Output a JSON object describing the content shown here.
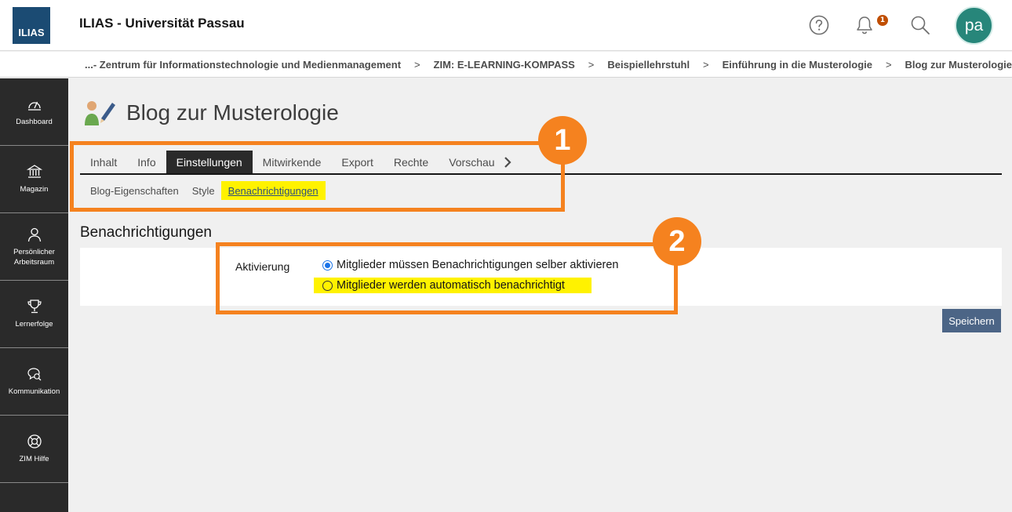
{
  "header": {
    "logo_text": "ILIAS",
    "app_title": "ILIAS - Universität Passau",
    "notification_count": "1",
    "avatar_initials": "pa",
    "icons": [
      "help-icon",
      "bell-icon",
      "search-icon"
    ]
  },
  "breadcrumb": {
    "items": [
      "...- Zentrum für Informationstechnologie und Medienmanagement",
      "ZIM: E-LEARNING-KOMPASS",
      "Beispiellehrstuhl",
      "Einführung in die Musterologie",
      "Blog zur Musterologie"
    ],
    "separator": ">"
  },
  "sidebar": {
    "items": [
      {
        "label": "Dashboard",
        "icon": "dashboard-icon"
      },
      {
        "label": "Magazin",
        "icon": "library-icon"
      },
      {
        "label": "Persönlicher Arbeitsraum",
        "icon": "person-icon"
      },
      {
        "label": "Lernerfolge",
        "icon": "trophy-icon"
      },
      {
        "label": "Kommunikation",
        "icon": "chat-icon"
      },
      {
        "label": "ZIM Hilfe",
        "icon": "lifebuoy-icon"
      }
    ]
  },
  "main": {
    "page_title": "Blog zur Musterologie",
    "tabs": [
      {
        "label": "Inhalt",
        "active": false
      },
      {
        "label": "Info",
        "active": false
      },
      {
        "label": "Einstellungen",
        "active": true
      },
      {
        "label": "Mitwirkende",
        "active": false
      },
      {
        "label": "Export",
        "active": false
      },
      {
        "label": "Rechte",
        "active": false
      },
      {
        "label": "Vorschau",
        "active": false
      }
    ],
    "subtabs": [
      {
        "label": "Blog-Eigenschaften",
        "active": false
      },
      {
        "label": "Style",
        "active": false
      },
      {
        "label": "Benachrichtigungen",
        "active": true
      }
    ],
    "section_title": "Benachrichtigungen",
    "form": {
      "label": "Aktivierung",
      "options": [
        {
          "label": "Mitglieder müssen Benachrichtigungen selber aktivieren",
          "checked": true
        },
        {
          "label": "Mitglieder werden automatisch benachrichtigt",
          "checked": false
        }
      ]
    },
    "save_label": "Speichern"
  },
  "annotations": {
    "marker_1": "1",
    "marker_2": "2",
    "color": "#f5821f",
    "highlight_color": "#fff200"
  },
  "colors": {
    "sidebar_bg": "#2a2a2a",
    "logo_bg": "#1b4b73",
    "avatar_bg": "#27867a",
    "badge": "#c04e00",
    "button": "#4c6586"
  }
}
